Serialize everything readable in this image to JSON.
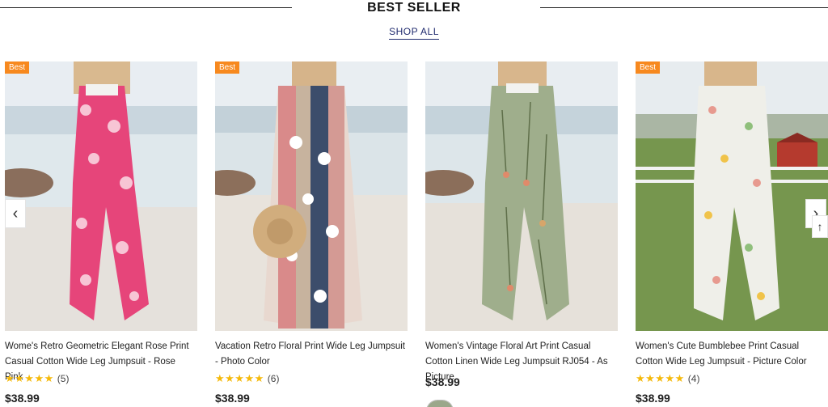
{
  "section": {
    "title": "BEST SELLER",
    "shop_all": "SHOP ALL"
  },
  "colors": {
    "badge": "#f7891f",
    "stars": "#f5b90a",
    "link": "#1f2a6e"
  },
  "icons": {
    "prev": "chevron-left-icon",
    "next": "chevron-right-icon",
    "back_to_top": "arrow-up-icon",
    "rating": "star-icon"
  },
  "products": [
    {
      "badge": "Best",
      "name": "Wome's Retro Geometric Elegant Rose Print Casual Cotton Wide Leg Jumpsuit - Rose Pink",
      "stars": "★★★★★",
      "rating": 5,
      "review_count": "(5)",
      "price": "$38.99"
    },
    {
      "badge": "Best",
      "name": "Vacation Retro Floral Print Wide Leg Jumpsuit - Photo Color",
      "stars": "★★★★★",
      "rating": 5,
      "review_count": "(6)",
      "price": "$38.99"
    },
    {
      "badge": "",
      "name": "Women's Vintage Floral Art Print Casual Cotton Linen Wide Leg Jumpsuit RJ054 - As Picture",
      "price": "$38.99"
    },
    {
      "badge": "Best",
      "name": "Women's Cute Bumblebee Print Casual Cotton Wide Leg Jumpsuit - Picture Color",
      "stars": "★★★★★",
      "rating": 5,
      "review_count": "(4)",
      "price": "$38.99"
    }
  ],
  "nav": {
    "prev_glyph": "‹",
    "next_glyph": "›",
    "back_to_top_glyph": "↑"
  }
}
